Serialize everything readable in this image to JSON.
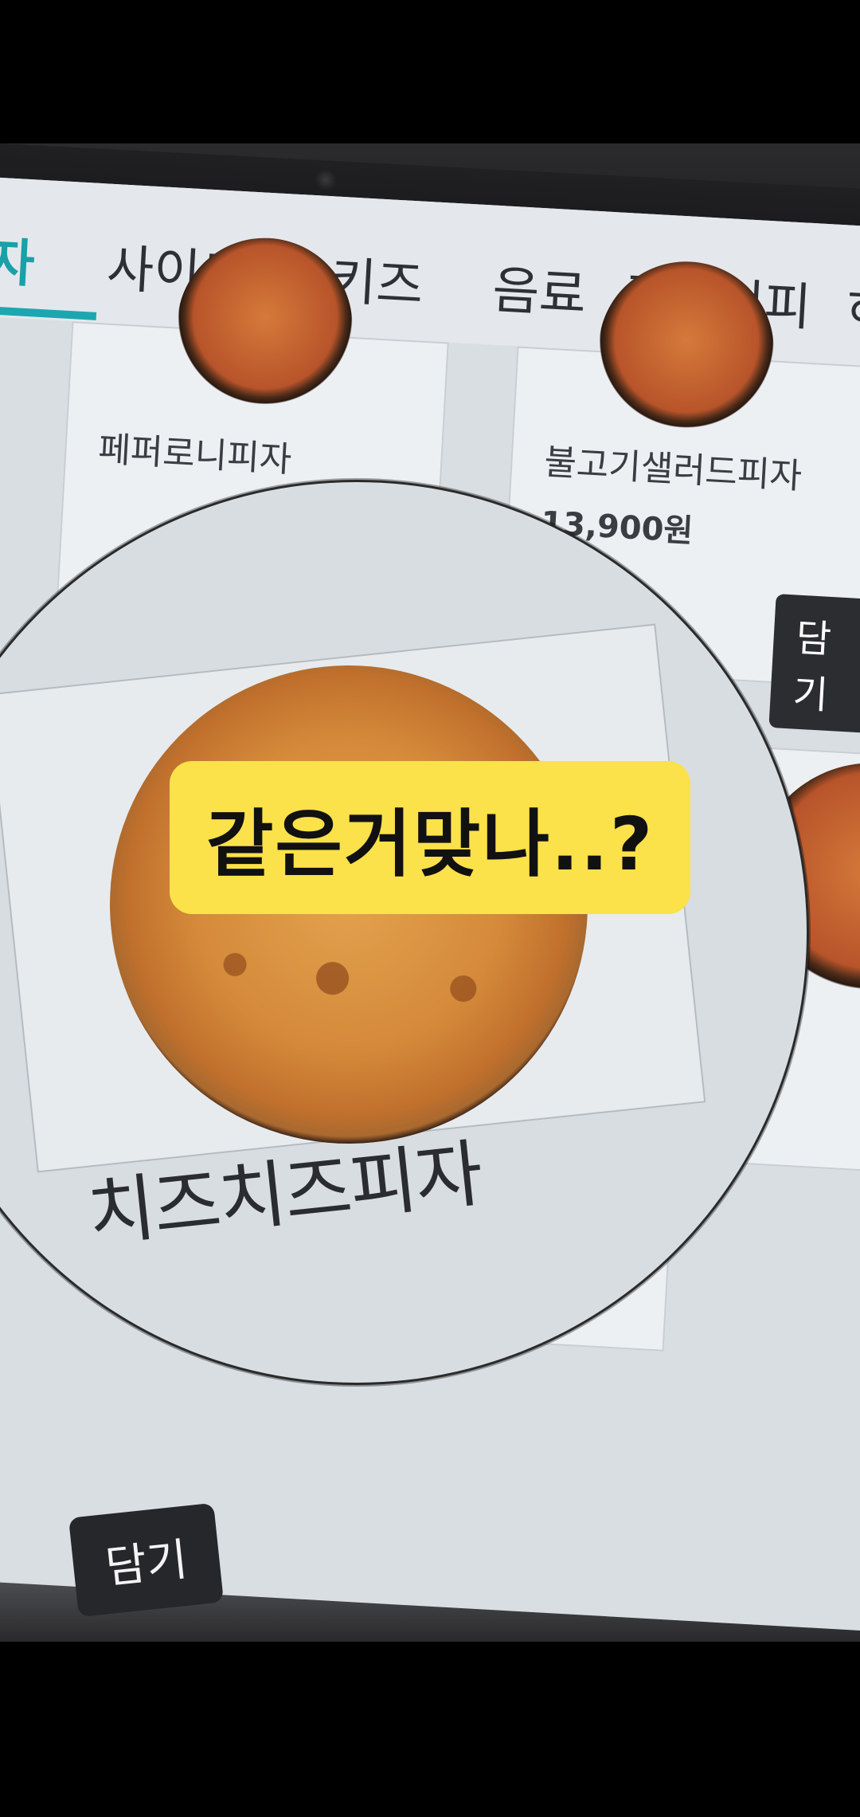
{
  "tabs": [
    {
      "label": "자"
    },
    {
      "label": "사이드"
    },
    {
      "label": "키즈"
    },
    {
      "label": "음료"
    },
    {
      "label": "킴보커피"
    },
    {
      "label": "허"
    }
  ],
  "cards": {
    "pepperoni": {
      "name": "페퍼로니피자"
    },
    "bulgogi": {
      "name": "불고기샐러드피자",
      "price": "13,900원"
    }
  },
  "magnifier": {
    "product_name": "치즈치즈피자"
  },
  "add_button": "담기",
  "side_add_button": "담기",
  "caption": "같은거맞나..?"
}
